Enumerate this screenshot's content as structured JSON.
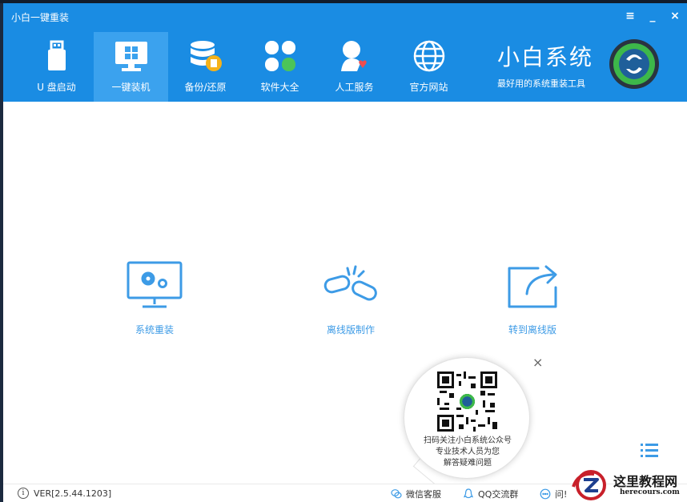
{
  "window": {
    "title": "小白一键重装"
  },
  "window_controls": {
    "menu": "≡",
    "minimize": "_",
    "close": "×"
  },
  "nav": {
    "items": [
      {
        "label": "U 盘启动",
        "icon": "usb-drive-icon"
      },
      {
        "label": "一键装机",
        "icon": "monitor-windows-icon",
        "active": true
      },
      {
        "label": "备份/还原",
        "icon": "database-backup-icon"
      },
      {
        "label": "软件大全",
        "icon": "apps-grid-icon"
      },
      {
        "label": "人工服务",
        "icon": "user-heart-icon"
      },
      {
        "label": "官方网站",
        "icon": "globe-icon"
      }
    ]
  },
  "brand": {
    "name": "小白系统",
    "slogan": "最好用的系统重装工具"
  },
  "actions": [
    {
      "label": "系统重装",
      "icon": "monitor-gears-icon"
    },
    {
      "label": "离线版制作",
      "icon": "broken-link-icon"
    },
    {
      "label": "转到离线版",
      "icon": "share-export-icon"
    }
  ],
  "qr_bubble": {
    "close": "×",
    "lines": [
      "扫码关注小白系统公众号",
      "专业技术人员为您",
      "解答疑难问题"
    ]
  },
  "statusbar": {
    "version": "VER[2.5.44.1203]",
    "wechat": "微信客服",
    "qq": "QQ交流群",
    "feedback": "问!"
  },
  "watermark": {
    "title": "这里教程网",
    "url": "herecours.com"
  },
  "colors": {
    "header": "#1a8ce3",
    "active_tab": "#3ba2ee",
    "accent": "#3d9be6"
  }
}
